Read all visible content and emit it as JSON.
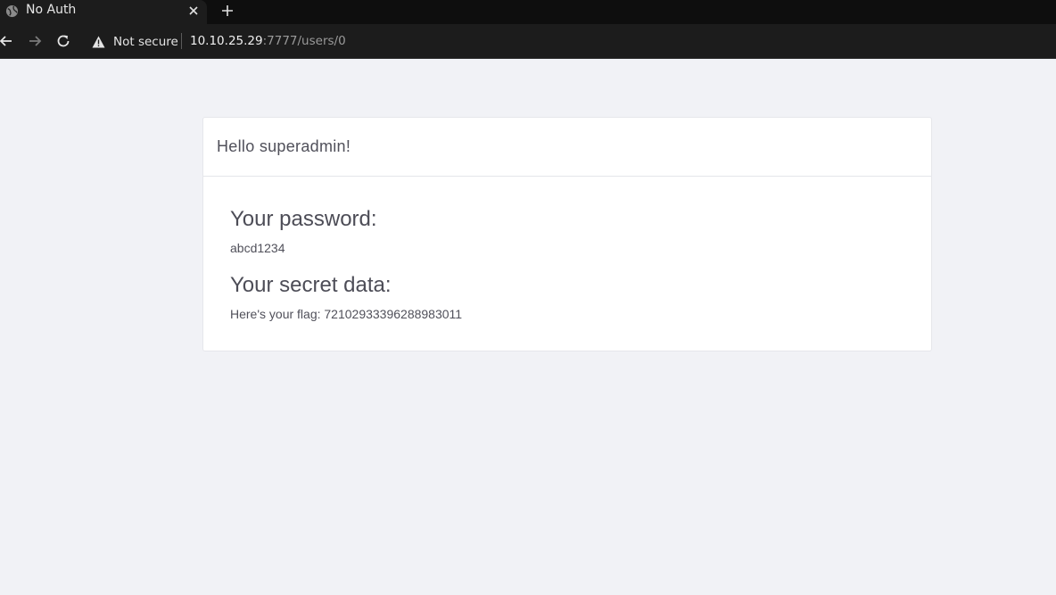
{
  "browser": {
    "tab_title": "No Auth",
    "security_label": "Not secure",
    "url_host": "10.10.25.29",
    "url_rest": ":7777/users/0",
    "icons": {
      "favicon": "globe-icon",
      "tab_close": "close-icon",
      "new_tab": "plus-icon",
      "back": "arrow-left-icon",
      "forward": "arrow-right-icon",
      "reload": "reload-icon",
      "security": "warning-triangle-icon"
    }
  },
  "page": {
    "greeting": "Hello superadmin!",
    "password_heading": "Your password:",
    "password_value": "abcd1234",
    "secret_heading": "Your secret data:",
    "secret_value": "Here's your flag: 72102933396288983011"
  },
  "colors": {
    "page_background": "#f1f2f6",
    "card_background": "#ffffff",
    "chrome_background": "#1c1c1c"
  }
}
